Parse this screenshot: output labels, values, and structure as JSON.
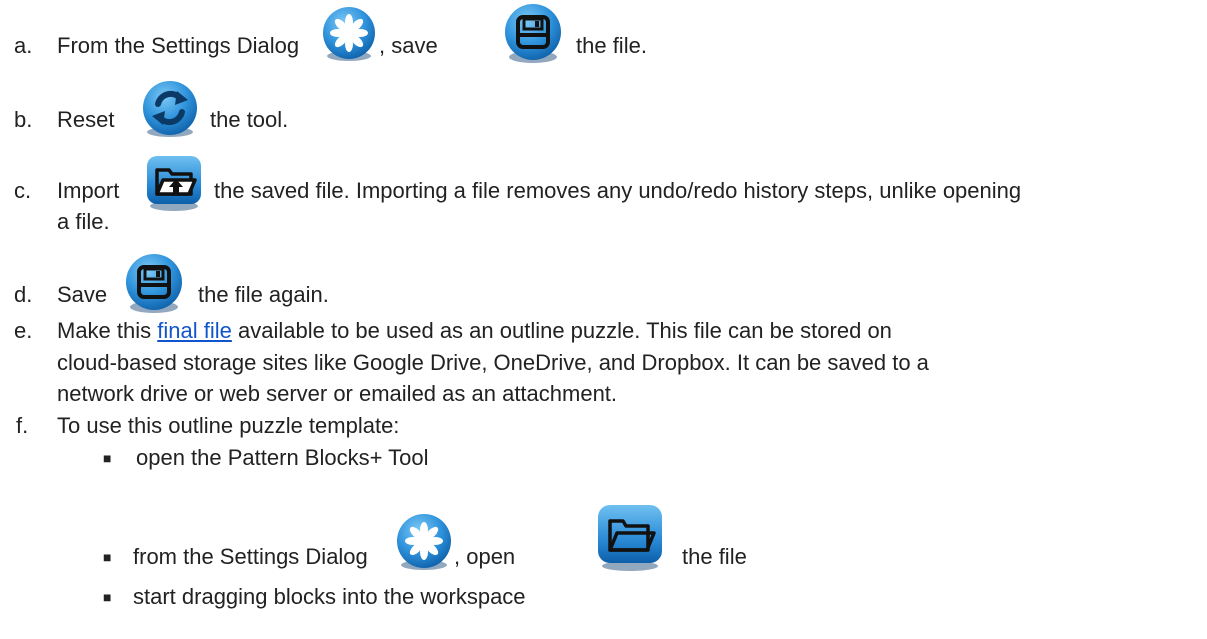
{
  "steps": [
    {
      "marker": "a.",
      "t1": "From the Settings Dialog",
      "t2": ", save",
      "t3": "the file."
    },
    {
      "marker": "b.",
      "t1": "Reset",
      "t2": "the tool."
    },
    {
      "marker": "c.",
      "t1": "Import",
      "t2": "the saved file. Importing a file removes any undo/redo history steps, unlike opening",
      "t3": "a file."
    },
    {
      "marker": "d.",
      "t1": "Save",
      "t2": "the file again."
    },
    {
      "marker": "e.",
      "t1": "Make this",
      "link": "final file",
      "t2": "available to be used as an outline puzzle. This file can be stored on",
      "t3": "cloud-based storage sites like Google Drive, OneDrive, and Dropbox. It can be saved to a",
      "t4": "network drive or web server or emailed as an attachment."
    },
    {
      "marker": "f.",
      "t1": "To use this outline puzzle template:"
    }
  ],
  "subitems": [
    {
      "bullet": "■",
      "t1": "open the Pattern Blocks+ Tool"
    },
    {
      "bullet": "■",
      "t1": "from the Settings Dialog",
      "t2": ", open",
      "t3": "the file"
    },
    {
      "bullet": "■",
      "t1": "start dragging blocks into the workspace"
    }
  ],
  "icons": {
    "settings": "gear-icon",
    "save": "floppy-disk-icon",
    "reset": "refresh-icon",
    "import": "folder-import-icon",
    "open": "folder-open-icon"
  },
  "colors": {
    "text": "#222222",
    "link": "#1155cc",
    "icon_blue": "#1e88d8",
    "icon_dark": "#0b4f8f"
  }
}
